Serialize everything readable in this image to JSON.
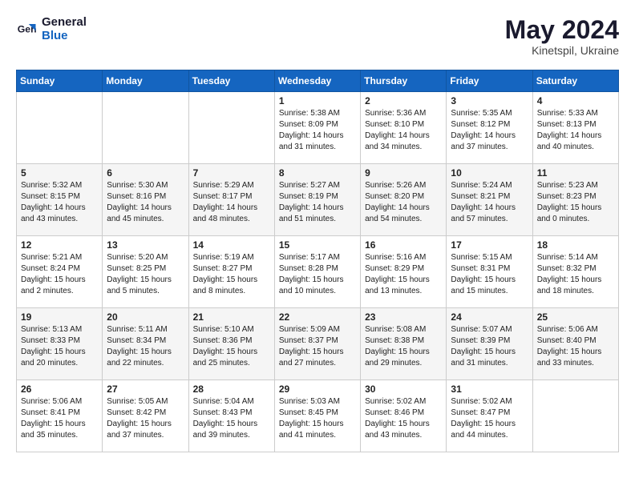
{
  "header": {
    "logo_general": "General",
    "logo_blue": "Blue",
    "month_title": "May 2024",
    "location": "Kinetspil, Ukraine"
  },
  "weekdays": [
    "Sunday",
    "Monday",
    "Tuesday",
    "Wednesday",
    "Thursday",
    "Friday",
    "Saturday"
  ],
  "weeks": [
    [
      {
        "day": "",
        "info": ""
      },
      {
        "day": "",
        "info": ""
      },
      {
        "day": "",
        "info": ""
      },
      {
        "day": "1",
        "info": "Sunrise: 5:38 AM\nSunset: 8:09 PM\nDaylight: 14 hours\nand 31 minutes."
      },
      {
        "day": "2",
        "info": "Sunrise: 5:36 AM\nSunset: 8:10 PM\nDaylight: 14 hours\nand 34 minutes."
      },
      {
        "day": "3",
        "info": "Sunrise: 5:35 AM\nSunset: 8:12 PM\nDaylight: 14 hours\nand 37 minutes."
      },
      {
        "day": "4",
        "info": "Sunrise: 5:33 AM\nSunset: 8:13 PM\nDaylight: 14 hours\nand 40 minutes."
      }
    ],
    [
      {
        "day": "5",
        "info": "Sunrise: 5:32 AM\nSunset: 8:15 PM\nDaylight: 14 hours\nand 43 minutes."
      },
      {
        "day": "6",
        "info": "Sunrise: 5:30 AM\nSunset: 8:16 PM\nDaylight: 14 hours\nand 45 minutes."
      },
      {
        "day": "7",
        "info": "Sunrise: 5:29 AM\nSunset: 8:17 PM\nDaylight: 14 hours\nand 48 minutes."
      },
      {
        "day": "8",
        "info": "Sunrise: 5:27 AM\nSunset: 8:19 PM\nDaylight: 14 hours\nand 51 minutes."
      },
      {
        "day": "9",
        "info": "Sunrise: 5:26 AM\nSunset: 8:20 PM\nDaylight: 14 hours\nand 54 minutes."
      },
      {
        "day": "10",
        "info": "Sunrise: 5:24 AM\nSunset: 8:21 PM\nDaylight: 14 hours\nand 57 minutes."
      },
      {
        "day": "11",
        "info": "Sunrise: 5:23 AM\nSunset: 8:23 PM\nDaylight: 15 hours\nand 0 minutes."
      }
    ],
    [
      {
        "day": "12",
        "info": "Sunrise: 5:21 AM\nSunset: 8:24 PM\nDaylight: 15 hours\nand 2 minutes."
      },
      {
        "day": "13",
        "info": "Sunrise: 5:20 AM\nSunset: 8:25 PM\nDaylight: 15 hours\nand 5 minutes."
      },
      {
        "day": "14",
        "info": "Sunrise: 5:19 AM\nSunset: 8:27 PM\nDaylight: 15 hours\nand 8 minutes."
      },
      {
        "day": "15",
        "info": "Sunrise: 5:17 AM\nSunset: 8:28 PM\nDaylight: 15 hours\nand 10 minutes."
      },
      {
        "day": "16",
        "info": "Sunrise: 5:16 AM\nSunset: 8:29 PM\nDaylight: 15 hours\nand 13 minutes."
      },
      {
        "day": "17",
        "info": "Sunrise: 5:15 AM\nSunset: 8:31 PM\nDaylight: 15 hours\nand 15 minutes."
      },
      {
        "day": "18",
        "info": "Sunrise: 5:14 AM\nSunset: 8:32 PM\nDaylight: 15 hours\nand 18 minutes."
      }
    ],
    [
      {
        "day": "19",
        "info": "Sunrise: 5:13 AM\nSunset: 8:33 PM\nDaylight: 15 hours\nand 20 minutes."
      },
      {
        "day": "20",
        "info": "Sunrise: 5:11 AM\nSunset: 8:34 PM\nDaylight: 15 hours\nand 22 minutes."
      },
      {
        "day": "21",
        "info": "Sunrise: 5:10 AM\nSunset: 8:36 PM\nDaylight: 15 hours\nand 25 minutes."
      },
      {
        "day": "22",
        "info": "Sunrise: 5:09 AM\nSunset: 8:37 PM\nDaylight: 15 hours\nand 27 minutes."
      },
      {
        "day": "23",
        "info": "Sunrise: 5:08 AM\nSunset: 8:38 PM\nDaylight: 15 hours\nand 29 minutes."
      },
      {
        "day": "24",
        "info": "Sunrise: 5:07 AM\nSunset: 8:39 PM\nDaylight: 15 hours\nand 31 minutes."
      },
      {
        "day": "25",
        "info": "Sunrise: 5:06 AM\nSunset: 8:40 PM\nDaylight: 15 hours\nand 33 minutes."
      }
    ],
    [
      {
        "day": "26",
        "info": "Sunrise: 5:06 AM\nSunset: 8:41 PM\nDaylight: 15 hours\nand 35 minutes."
      },
      {
        "day": "27",
        "info": "Sunrise: 5:05 AM\nSunset: 8:42 PM\nDaylight: 15 hours\nand 37 minutes."
      },
      {
        "day": "28",
        "info": "Sunrise: 5:04 AM\nSunset: 8:43 PM\nDaylight: 15 hours\nand 39 minutes."
      },
      {
        "day": "29",
        "info": "Sunrise: 5:03 AM\nSunset: 8:45 PM\nDaylight: 15 hours\nand 41 minutes."
      },
      {
        "day": "30",
        "info": "Sunrise: 5:02 AM\nSunset: 8:46 PM\nDaylight: 15 hours\nand 43 minutes."
      },
      {
        "day": "31",
        "info": "Sunrise: 5:02 AM\nSunset: 8:47 PM\nDaylight: 15 hours\nand 44 minutes."
      },
      {
        "day": "",
        "info": ""
      }
    ]
  ]
}
